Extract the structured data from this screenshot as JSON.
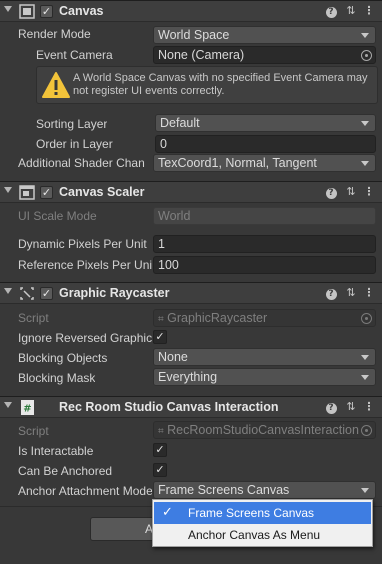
{
  "canvas": {
    "title": "Canvas",
    "render_mode_label": "Render Mode",
    "render_mode_value": "World Space",
    "event_camera_label": "Event Camera",
    "event_camera_value": "None (Camera)",
    "warning_text": "A World Space Canvas with no specified Event Camera may not register UI events correctly.",
    "sorting_layer_label": "Sorting Layer",
    "sorting_layer_value": "Default",
    "order_in_layer_label": "Order in Layer",
    "order_in_layer_value": "0",
    "shader_channels_label": "Additional Shader Chan",
    "shader_channels_value": "TexCoord1, Normal, Tangent"
  },
  "canvas_scaler": {
    "title": "Canvas Scaler",
    "ui_scale_mode_label": "UI Scale Mode",
    "ui_scale_mode_value": "World",
    "dynamic_pixels_label": "Dynamic Pixels Per Unit",
    "dynamic_pixels_value": "1",
    "reference_pixels_label": "Reference Pixels Per Unit",
    "reference_pixels_value": "100"
  },
  "graphic_raycaster": {
    "title": "Graphic Raycaster",
    "script_label": "Script",
    "script_value": "GraphicRaycaster",
    "ignore_reversed_label": "Ignore Reversed Graphics",
    "blocking_objects_label": "Blocking Objects",
    "blocking_objects_value": "None",
    "blocking_mask_label": "Blocking Mask",
    "blocking_mask_value": "Everything"
  },
  "rec_room": {
    "title": "Rec Room Studio Canvas Interaction",
    "script_label": "Script",
    "script_value": "RecRoomStudioCanvasInteraction",
    "is_interactable_label": "Is Interactable",
    "can_be_anchored_label": "Can Be Anchored",
    "anchor_mode_label": "Anchor Attachment Mode",
    "anchor_mode_value": "Frame Screens Canvas"
  },
  "popup_options": [
    {
      "label": "Frame Screens Canvas",
      "selected": true
    },
    {
      "label": "Anchor Canvas As Menu",
      "selected": false
    }
  ],
  "add_component_label": "Add Component",
  "colors": {
    "background": "#383838",
    "header": "#3e3e3e",
    "selection": "#3e7de2",
    "warning": "#f2c33a"
  }
}
